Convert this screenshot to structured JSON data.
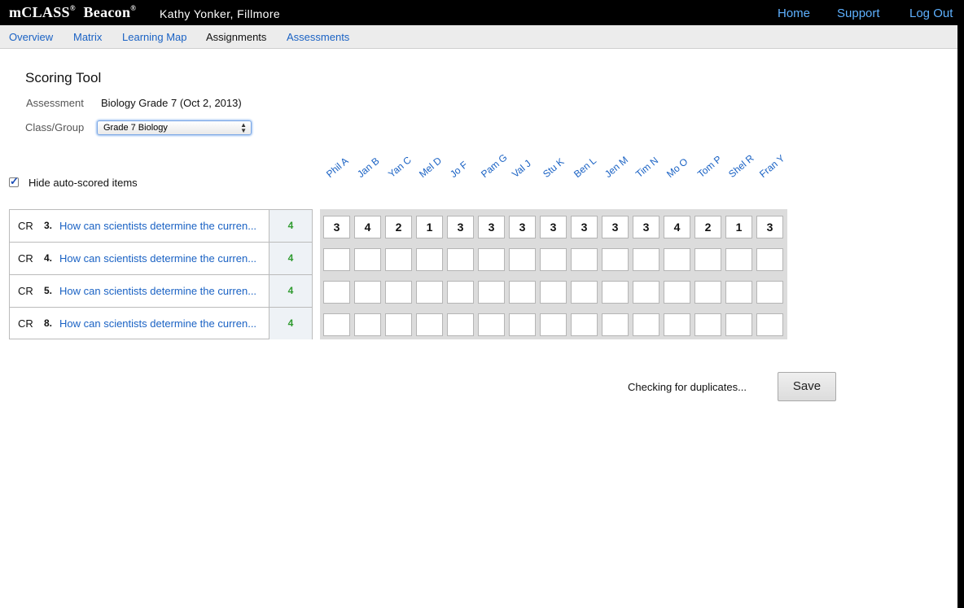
{
  "header": {
    "brand": "mCLASS",
    "brand_suffix": "Beacon",
    "registered_mark": "®",
    "user": "Kathy Yonker, Fillmore",
    "links": [
      "Home",
      "Support",
      "Log Out"
    ]
  },
  "nav": {
    "tabs": [
      "Overview",
      "Matrix",
      "Learning Map",
      "Assignments",
      "Assessments"
    ],
    "active": "Assignments"
  },
  "page": {
    "title": "Scoring Tool",
    "assessment_label": "Assessment",
    "assessment_value": "Biology Grade 7 (Oct 2, 2013)",
    "class_label": "Class/Group",
    "class_value": "Grade 7 Biology",
    "hide_label": "Hide auto-scored items",
    "hide_checked": true
  },
  "students": [
    "Phil A",
    "Jan B",
    "Yan C",
    "Mel D",
    "Jo F",
    "Pam G",
    "Val J",
    "Stu K",
    "Ben L",
    "Jen M",
    "Tim N",
    "Mo O",
    "Tom P",
    "Shel R",
    "Fran Y"
  ],
  "items": [
    {
      "type": "CR",
      "number": "3.",
      "text": "How can scientists determine the curren...",
      "points": "4"
    },
    {
      "type": "CR",
      "number": "4.",
      "text": "How can scientists determine the curren...",
      "points": "4"
    },
    {
      "type": "CR",
      "number": "5.",
      "text": "How can scientists determine the curren...",
      "points": "4"
    },
    {
      "type": "CR",
      "number": "8.",
      "text": "How can scientists determine the curren...",
      "points": "4"
    }
  ],
  "scores": [
    [
      "3",
      "4",
      "2",
      "1",
      "3",
      "3",
      "3",
      "3",
      "3",
      "3",
      "3",
      "4",
      "2",
      "1",
      "3"
    ],
    [
      "",
      "",
      "",
      "",
      "",
      "",
      "",
      "",
      "",
      "",
      "",
      "",
      "",
      "",
      ""
    ],
    [
      "",
      "",
      "",
      "",
      "",
      "",
      "",
      "",
      "",
      "",
      "",
      "",
      "",
      "",
      ""
    ],
    [
      "",
      "",
      "",
      "",
      "",
      "",
      "",
      "",
      "",
      "",
      "",
      "",
      "",
      "",
      ""
    ]
  ],
  "footer": {
    "status": "Checking for duplicates...",
    "save_label": "Save"
  }
}
